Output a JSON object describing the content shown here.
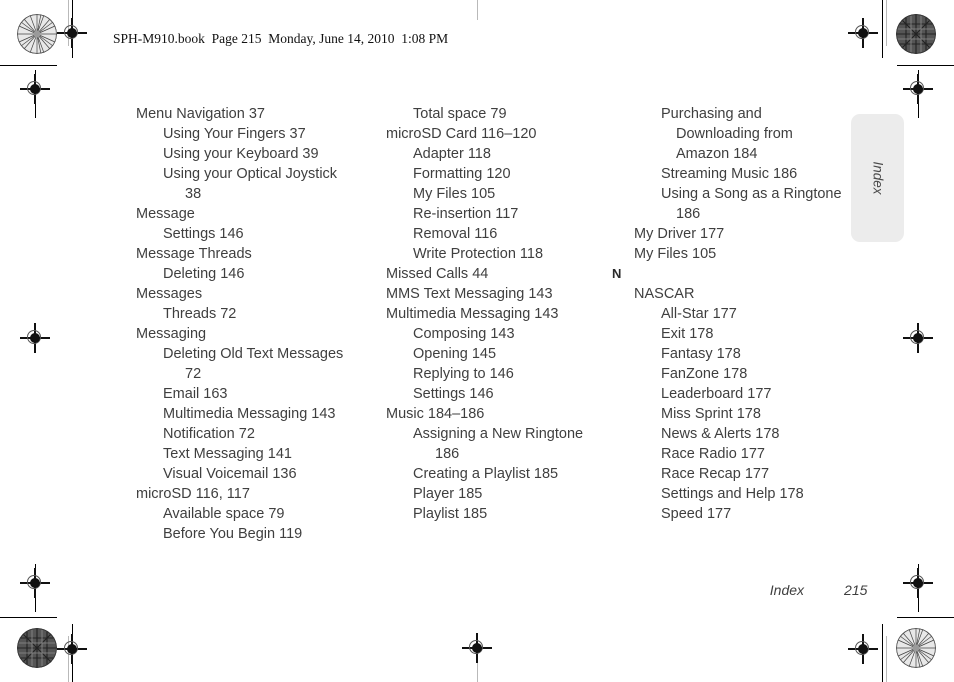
{
  "header": {
    "text": "SPH-M910.book  Page 215  Monday, June 14, 2010  1:08 PM"
  },
  "side_tab": {
    "label": "Index"
  },
  "footer": {
    "label": "Index",
    "page": "215"
  },
  "colors": {
    "text": "#3f3f3f",
    "header_text": "#111111",
    "tab_background": "#ececec",
    "crop_mark": "#000000"
  },
  "columns": [
    {
      "id": "column-1",
      "entries": [
        {
          "level": 1,
          "text": "Menu Navigation 37"
        },
        {
          "level": 2,
          "text": "Using Your Fingers 37"
        },
        {
          "level": 2,
          "text": "Using your Keyboard 39"
        },
        {
          "level": 2,
          "text": "Using your Optical Joystick"
        },
        {
          "level": 3,
          "text": "38"
        },
        {
          "level": 1,
          "text": "Message"
        },
        {
          "level": 2,
          "text": "Settings 146"
        },
        {
          "level": 1,
          "text": "Message Threads"
        },
        {
          "level": 2,
          "text": "Deleting 146"
        },
        {
          "level": 1,
          "text": "Messages"
        },
        {
          "level": 2,
          "text": "Threads 72"
        },
        {
          "level": 1,
          "text": "Messaging"
        },
        {
          "level": 2,
          "text": "Deleting Old Text Messages"
        },
        {
          "level": 3,
          "text": "72"
        },
        {
          "level": 2,
          "text": "Email 163"
        },
        {
          "level": 2,
          "text": "Multimedia Messaging 143"
        },
        {
          "level": 2,
          "text": "Notification 72"
        },
        {
          "level": 2,
          "text": "Text Messaging 141"
        },
        {
          "level": 2,
          "text": "Visual Voicemail 136"
        },
        {
          "level": 1,
          "text": "microSD 116, 117"
        },
        {
          "level": 2,
          "text": "Available space 79"
        },
        {
          "level": 2,
          "text": "Before You Begin 119"
        }
      ]
    },
    {
      "id": "column-2",
      "entries": [
        {
          "level": 2,
          "text": "Total space 79"
        },
        {
          "level": 1,
          "text": "microSD Card 116–120"
        },
        {
          "level": 2,
          "text": "Adapter 118"
        },
        {
          "level": 2,
          "text": "Formatting 120"
        },
        {
          "level": 2,
          "text": "My Files 105"
        },
        {
          "level": 2,
          "text": "Re-insertion 117"
        },
        {
          "level": 2,
          "text": "Removal 116"
        },
        {
          "level": 2,
          "text": "Write Protection 118"
        },
        {
          "level": 1,
          "text": "Missed Calls 44"
        },
        {
          "level": 1,
          "text": "MMS Text Messaging 143"
        },
        {
          "level": 1,
          "text": "Multimedia Messaging 143"
        },
        {
          "level": 2,
          "text": "Composing 143"
        },
        {
          "level": 2,
          "text": "Opening 145"
        },
        {
          "level": 2,
          "text": "Replying to 146"
        },
        {
          "level": 2,
          "text": "Settings 146"
        },
        {
          "level": 1,
          "text": "Music 184–186"
        },
        {
          "level": 2,
          "text": "Assigning a New Ringtone"
        },
        {
          "level": 3,
          "text": "186"
        },
        {
          "level": 2,
          "text": "Creating a Playlist 185"
        },
        {
          "level": 2,
          "text": "Player 185"
        },
        {
          "level": 2,
          "text": "Playlist 185"
        }
      ]
    },
    {
      "id": "column-3",
      "entries": [
        {
          "level": 2,
          "text": "Purchasing and"
        },
        {
          "level": 3,
          "text": "Downloading from"
        },
        {
          "level": 3,
          "text": "Amazon 184"
        },
        {
          "level": 2,
          "text": "Streaming Music 186"
        },
        {
          "level": 2,
          "text": "Using a Song as a Ringtone"
        },
        {
          "level": 3,
          "text": "186"
        },
        {
          "level": 1,
          "text": "My Driver 177"
        },
        {
          "level": 1,
          "text": "My Files 105"
        },
        {
          "level": 0,
          "text": "N"
        },
        {
          "level": 1,
          "text": "NASCAR"
        },
        {
          "level": 2,
          "text": "All-Star 177"
        },
        {
          "level": 2,
          "text": "Exit 178"
        },
        {
          "level": 2,
          "text": "Fantasy 178"
        },
        {
          "level": 2,
          "text": "FanZone 178"
        },
        {
          "level": 2,
          "text": "Leaderboard 177"
        },
        {
          "level": 2,
          "text": "Miss Sprint 178"
        },
        {
          "level": 2,
          "text": "News &amp; Alerts 178"
        },
        {
          "level": 2,
          "text": "Race Radio 177"
        },
        {
          "level": 2,
          "text": "Race Recap 177"
        },
        {
          "level": 2,
          "text": "Settings and Help 178"
        },
        {
          "level": 2,
          "text": "Speed 177"
        }
      ]
    }
  ],
  "print_marks": {
    "registration_icon": "registration-target-icon",
    "starburst_icon": "starburst-calibration-icon"
  }
}
